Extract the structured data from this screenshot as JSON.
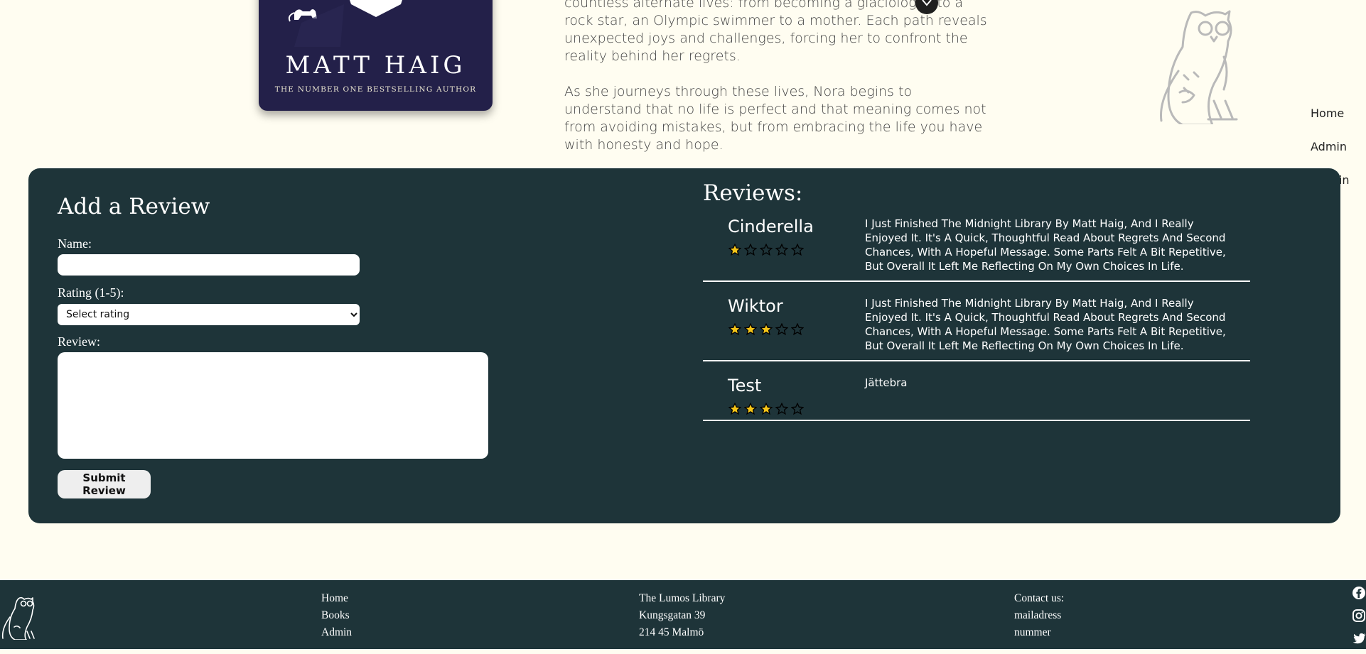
{
  "book": {
    "cover_author": "MATT HAIG",
    "cover_tagline": "THE NUMBER ONE BESTSELLING AUTHOR",
    "description_p1": "countless alternate lives: from becoming a glaciologist to a rock star, an Olympic swimmer to a mother. Each path reveals unexpected joys and challenges, forcing her to confront the reality behind her regrets.",
    "description_p2": "As she journeys through these lives, Nora begins to understand that no life is perfect and that meaning comes not from avoiding mistakes, but from embracing the life you have with honesty and hope.",
    "badge_icon": "chevron-down-icon"
  },
  "nav": {
    "home": "Home",
    "admin": "Admin",
    "sign_in": "Sign in"
  },
  "review_form": {
    "title": "Add a Review",
    "name_label": "Name:",
    "name_value": "",
    "rating_label": "Rating (1-5):",
    "rating_selected": "Select rating",
    "review_label": "Review:",
    "review_value": "",
    "submit_label": "Submit Review"
  },
  "reviews": {
    "title": "Reviews:",
    "items": [
      {
        "name": "Cinderella",
        "rating": 1,
        "text": "I Just Finished The Midnight Library By Matt Haig, And I Really Enjoyed It. It's A Quick, Thoughtful Read About Regrets And Second Chances, With A Hopeful Message. Some Parts Felt A Bit Repetitive, But Overall It Left Me Reflecting On My Own Choices In Life."
      },
      {
        "name": "Wiktor",
        "rating": 3,
        "text": "I Just Finished The Midnight Library By Matt Haig, And I Really Enjoyed It. It's A Quick, Thoughtful Read About Regrets And Second Chances, With A Hopeful Message. Some Parts Felt A Bit Repetitive, But Overall It Left Me Reflecting On My Own Choices In Life."
      },
      {
        "name": "Test",
        "rating": 3,
        "text": "Jättebra"
      }
    ],
    "max_rating": 5
  },
  "footer": {
    "links": [
      "Home",
      "Books",
      "Admin"
    ],
    "address": [
      "The Lumos Library",
      "Kungsgatan 39",
      "214 45 Malmö"
    ],
    "contact": [
      "Contact us:",
      "mailadress",
      "nummer"
    ],
    "social_icons": [
      "facebook-icon",
      "instagram-icon",
      "twitter-icon"
    ]
  },
  "colors": {
    "page_bg": "#fffdf1",
    "panel_bg": "#1e3439",
    "star_filled": "#f5c518",
    "cover_bg": "#232049"
  }
}
